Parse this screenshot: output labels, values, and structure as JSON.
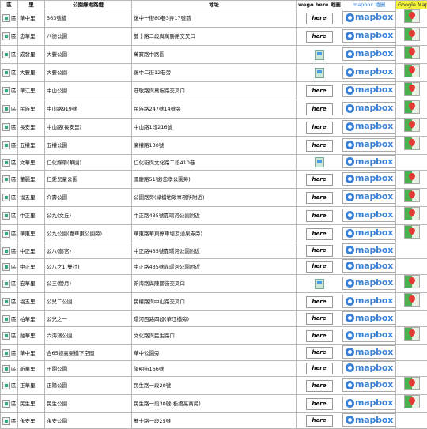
{
  "headers": {
    "district": "區",
    "village": "里",
    "park_name": "公園綠地路燈",
    "address": "地址",
    "here": "wego here 地圖",
    "mapbox": "mapbox 地圖",
    "google": "Google Map"
  },
  "rows": [
    {
      "d": "區3",
      "v": "華中里",
      "n": "363號橋",
      "a": "復中一街80巷3弄17號前",
      "here": "logo",
      "mb": true,
      "gm": true
    },
    {
      "d": "區2",
      "v": "忠華里",
      "n": "八德公園",
      "a": "雙十路二段與萬勝路交叉口",
      "here": "logo",
      "mb": true,
      "gm": true
    },
    {
      "d": "區5",
      "v": "成發里",
      "n": "大豐公園",
      "a": "萬寶路中路園",
      "here": "map",
      "mb": true,
      "gm": true
    },
    {
      "d": "區3",
      "v": "大豐里",
      "n": "大豐公園",
      "a": "復中二街12巷旁",
      "here": "map",
      "mb": true,
      "gm": true
    },
    {
      "d": "區2",
      "v": "華江里",
      "n": "中山公園",
      "a": "莊敬路與萬板路交叉口",
      "here": "logo",
      "mb": true,
      "gm": true
    },
    {
      "d": "區4",
      "v": "民族里",
      "n": "中山路919號",
      "a": "民族路247號14號旁",
      "here": "logo",
      "mb": true,
      "gm": true
    },
    {
      "d": "區5",
      "v": "長安里",
      "n": "中山路(長安里)",
      "a": "中山路1段216號",
      "here": "logo",
      "mb": true,
      "gm": true
    },
    {
      "d": "區4",
      "v": "五權里",
      "n": "五權公園",
      "a": "廣權路130號",
      "here": "logo",
      "mb": true,
      "gm": true
    },
    {
      "d": "區3",
      "v": "文華里",
      "n": "仁化綠帶(華園)",
      "a": "仁化街與文化路二段410巷",
      "here": "map",
      "mb": true,
      "gm": false
    },
    {
      "d": "區4",
      "v": "董麗里",
      "n": "仁愛兒童公園",
      "a": "國慶路51號(忠孝公園旁)",
      "here": "logo",
      "mb": true,
      "gm": true
    },
    {
      "d": "區3",
      "v": "福五里",
      "n": "介壽公園",
      "a": "公園路旁(綠檔地政事務所附近)",
      "here": "logo",
      "mb": true,
      "gm": true
    },
    {
      "d": "區4",
      "v": "中正里",
      "n": "公九(文丘)",
      "a": "中正路435號靠環河公園附近",
      "here": "logo",
      "mb": true,
      "gm": true
    },
    {
      "d": "區4",
      "v": "華東里",
      "n": "公九公園(嘉華東公園旁)",
      "a": "華東路華東停車場及湧泉寺旁)",
      "here": "logo",
      "mb": true,
      "gm": true
    },
    {
      "d": "區4",
      "v": "中正里",
      "n": "公八(藝宮)",
      "a": "中正路435號靠環河公園附近",
      "here": "logo",
      "mb": true,
      "gm": false
    },
    {
      "d": "區4",
      "v": "中正里",
      "n": "公八之1(雙社)",
      "a": "中正路435號靠環河公園附近",
      "here": "logo",
      "mb": true,
      "gm": false
    },
    {
      "d": "區3",
      "v": "宏華里",
      "n": "公三(營月)",
      "a": "新海路與陳國街交叉口",
      "here": "map",
      "mb": true,
      "gm": true
    },
    {
      "d": "區3",
      "v": "福五里",
      "n": "公兒二公園",
      "a": "民權路與中山路交叉口",
      "here": "logo",
      "mb": true,
      "gm": true
    },
    {
      "d": "區2",
      "v": "柏華里",
      "n": "公兒之一",
      "a": "環河西路四段(華江橋旁)",
      "here": "logo",
      "mb": true,
      "gm": false
    },
    {
      "d": "區2",
      "v": "融華里",
      "n": "六海濱公園",
      "a": "文化路與民生路口",
      "here": "logo",
      "mb": true,
      "gm": true
    },
    {
      "d": "區5",
      "v": "華中里",
      "n": "合65線高架橋下空間",
      "a": "華中公園旁",
      "here": "logo",
      "mb": true,
      "gm": false
    },
    {
      "d": "區2",
      "v": "新華里",
      "n": "田園公園",
      "a": "陽明街166號",
      "here": "logo",
      "mb": true,
      "gm": false
    },
    {
      "d": "區3",
      "v": "正華里",
      "n": "正陽公園",
      "a": "民生路一段20號",
      "here": "logo",
      "mb": true,
      "gm": true
    },
    {
      "d": "區3",
      "v": "民生里",
      "n": "民生公園",
      "a": "民生路一段30號(板橋高商旁)",
      "here": "logo",
      "mb": true,
      "gm": true
    },
    {
      "d": "區3",
      "v": "永安里",
      "n": "永安公園",
      "a": "雙十路一段25號",
      "here": "logo",
      "mb": true,
      "gm": false
    }
  ],
  "logos": {
    "here_text": "here",
    "mapbox_text": "mapbox"
  }
}
